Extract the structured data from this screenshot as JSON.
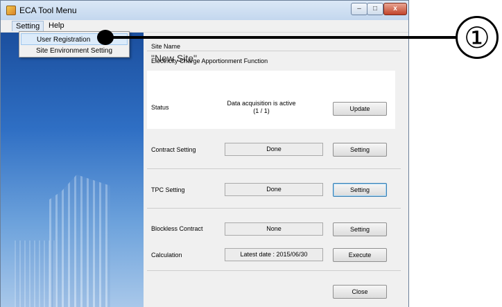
{
  "window": {
    "title": "ECA Tool Menu",
    "controls": {
      "minimize": "–",
      "maximize": "□",
      "close": "x"
    }
  },
  "menubar": {
    "items": [
      "Setting",
      "Help"
    ]
  },
  "dropdown": {
    "items": [
      "User Registration",
      "Site Environment Setting"
    ],
    "highlighted": "User Registration"
  },
  "left_panel": {
    "brand": ""
  },
  "site": {
    "name_label": "Site Name",
    "name_value": "\"New Site\""
  },
  "section": {
    "title": "Electricity Charge Apportionment Function"
  },
  "rows": {
    "status": {
      "label": "Status",
      "text_line1": "Data acquisition is active",
      "text_line2": "(1 / 1)",
      "button": "Update"
    },
    "contract": {
      "label": "Contract Setting",
      "value": "Done",
      "button": "Setting"
    },
    "tpc": {
      "label": "TPC Setting",
      "value": "Done",
      "button": "Setting"
    },
    "blockless": {
      "label": "Blockless Contract",
      "value": "None",
      "button": "Setting"
    },
    "calculation": {
      "label": "Calculation",
      "value": "Latest date : 2015/06/30",
      "button": "Execute"
    }
  },
  "footer": {
    "close_button": "Close"
  },
  "callout": {
    "number": "①"
  }
}
